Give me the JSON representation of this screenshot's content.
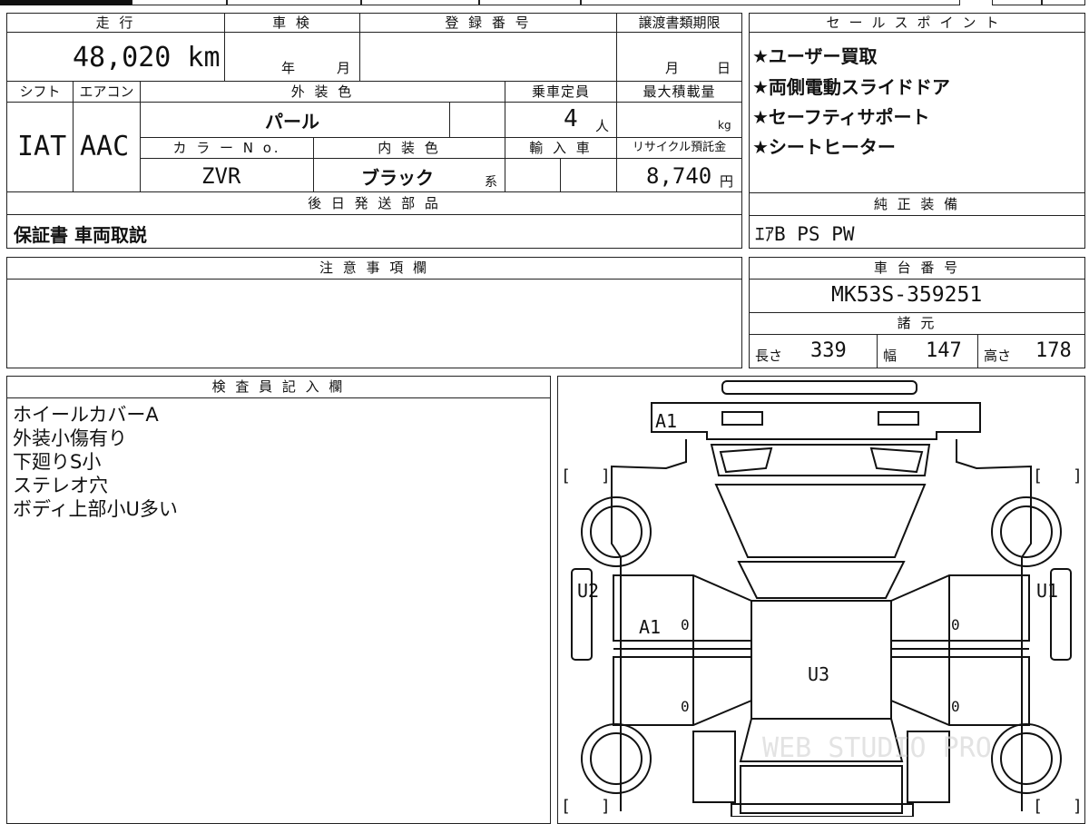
{
  "top_form": {
    "headers": {
      "mileage": "走 行",
      "inspection": "車 検",
      "registration": "登 録 番 号",
      "transfer_deadline": "譲渡書類期限",
      "shift": "シフト",
      "aircon": "エアコン",
      "exterior_color": "外 装 色",
      "capacity": "乗車定員",
      "max_load": "最大積載量",
      "color_no": "カ ラ ー N o.",
      "interior_color": "内 装 色",
      "import_car": "輸 入 車",
      "recycle_fee": "リサイクル預託金",
      "later_parts": "後 日 発 送 部 品"
    },
    "values": {
      "mileage": "48,020 km",
      "year_unit": "年",
      "month_unit": "月",
      "deadline_month": "月",
      "deadline_day": "日",
      "shift": "IAT",
      "aircon": "AAC",
      "exterior_color": "パール",
      "capacity_num": "4",
      "capacity_unit": "人",
      "load_unit": "kg",
      "color_no": "ZVR",
      "interior_color": "ブラック",
      "interior_suffix": "系",
      "recycle_amount": "8,740",
      "recycle_unit": "円",
      "later_parts": "保証書 車両取説"
    }
  },
  "sales_points": {
    "header": "セールスポイント",
    "items": [
      "★ユーザー買取",
      "★両側電動スライドドア",
      "★セーフティサポート",
      "★シートヒーター"
    ]
  },
  "genuine_equipment": {
    "header": "純 正 装 備",
    "value": "ｴｱB PS PW"
  },
  "notes": {
    "header": "注 意 事 項 欄"
  },
  "chassis": {
    "header": "車 台 番 号",
    "value": "MK53S-359251"
  },
  "specs": {
    "header": "諸 元",
    "length_label": "長さ",
    "length": "339",
    "width_label": "幅",
    "width": "147",
    "height_label": "高さ",
    "height": "178"
  },
  "inspector": {
    "header": "検 査 員 記 入 欄",
    "lines": [
      "ホイールカバーA",
      "外装小傷有り",
      "下廻りS小",
      "ステレオ穴",
      "ボディ上部小U多い"
    ]
  },
  "diagram": {
    "marks": {
      "a1_top": "A1",
      "u2": "U2",
      "u1": "U1",
      "a1_left": "A1",
      "u3": "U3",
      "zero_a": "0",
      "zero_b": "0",
      "zero_c": "0",
      "zero_d": "0"
    },
    "brackets": {
      "open": "[",
      "close": "]"
    },
    "watermark": "WEB STUDIO PRO"
  }
}
